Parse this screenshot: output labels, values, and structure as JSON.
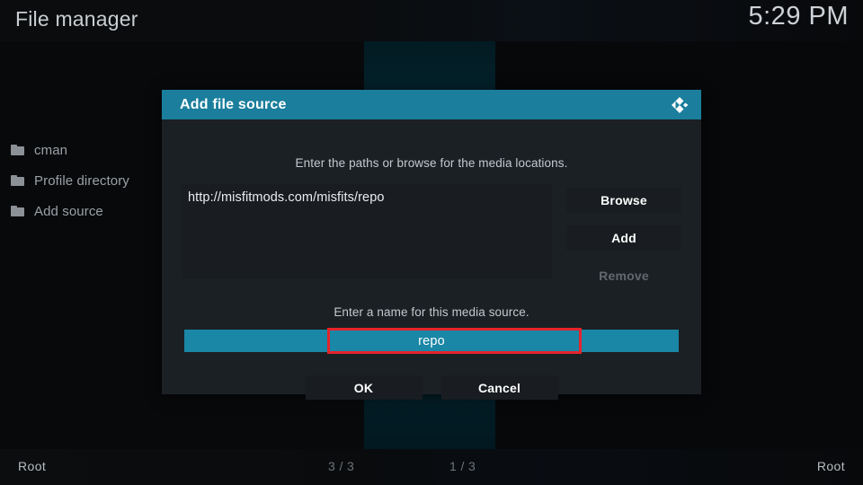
{
  "topbar": {
    "title": "File manager",
    "clock": "5:29 PM"
  },
  "sidebar": {
    "items": [
      {
        "label": "cman",
        "icon": "folder-icon"
      },
      {
        "label": "Profile directory",
        "icon": "folder-icon"
      },
      {
        "label": "Add source",
        "icon": "folder-icon"
      }
    ]
  },
  "statusbar": {
    "left_path": "Root",
    "left_count": "3 / 3",
    "right_count": "1 / 3",
    "right_path": "Root"
  },
  "dialog": {
    "title": "Add file source",
    "logo_icon": "kodi-logo-icon",
    "paths_hint": "Enter the paths or browse for the media locations.",
    "paths": [
      "http://misfitmods.com/misfits/repo"
    ],
    "side_buttons": [
      {
        "label": "Browse",
        "disabled": false
      },
      {
        "label": "Add",
        "disabled": false
      },
      {
        "label": "Remove",
        "disabled": true
      }
    ],
    "name_hint": "Enter a name for this media source.",
    "name_value": "repo",
    "ok_label": "OK",
    "cancel_label": "Cancel"
  },
  "colors": {
    "accent_teal": "#1a7e9c",
    "input_teal": "#1a87a6",
    "highlight_red": "#e5242c",
    "dialog_bg": "#1b2024",
    "field_bg": "#191d21"
  }
}
